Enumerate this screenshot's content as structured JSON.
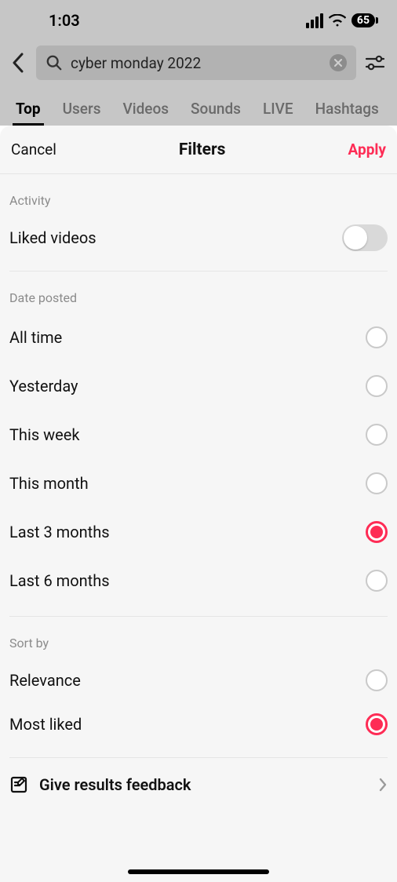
{
  "status": {
    "time": "1:03",
    "battery": "65"
  },
  "search": {
    "query": "cyber monday 2022"
  },
  "tabs": [
    {
      "label": "Top",
      "active": true
    },
    {
      "label": "Users",
      "active": false
    },
    {
      "label": "Videos",
      "active": false
    },
    {
      "label": "Sounds",
      "active": false
    },
    {
      "label": "LIVE",
      "active": false
    },
    {
      "label": "Hashtags",
      "active": false
    }
  ],
  "sheet": {
    "cancel": "Cancel",
    "title": "Filters",
    "apply": "Apply"
  },
  "activity": {
    "section_label": "Activity",
    "liked_videos_label": "Liked videos",
    "liked_videos_on": false
  },
  "date": {
    "section_label": "Date posted",
    "options": [
      {
        "label": "All time",
        "selected": false
      },
      {
        "label": "Yesterday",
        "selected": false
      },
      {
        "label": "This week",
        "selected": false
      },
      {
        "label": "This month",
        "selected": false
      },
      {
        "label": "Last 3 months",
        "selected": true
      },
      {
        "label": "Last 6 months",
        "selected": false
      }
    ]
  },
  "sort": {
    "section_label": "Sort by",
    "options": [
      {
        "label": "Relevance",
        "selected": false
      },
      {
        "label": "Most liked",
        "selected": true
      }
    ]
  },
  "feedback": {
    "label": "Give results feedback"
  },
  "colors": {
    "accent": "#fe2c55"
  }
}
